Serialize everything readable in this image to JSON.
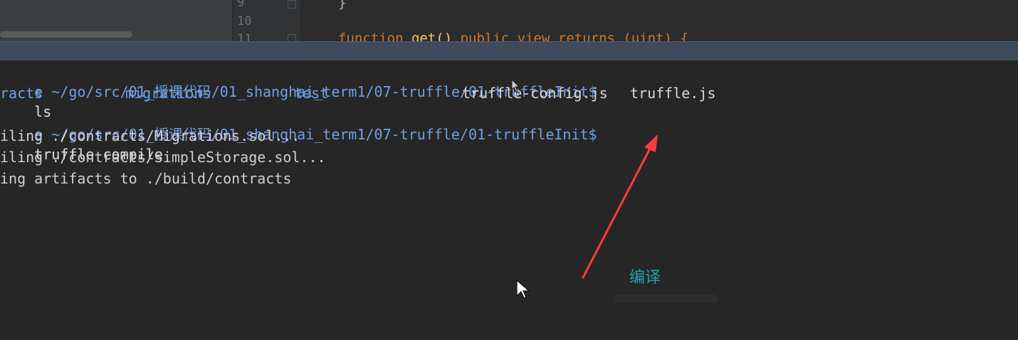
{
  "editor": {
    "line_numbers": [
      "9",
      "10",
      "11"
    ],
    "closing_brace": "}",
    "code_keyword1": "function",
    "code_fn": "get()",
    "code_rest": " public view returns (uint) {"
  },
  "terminal": {
    "prompt1": "e ~/go/src/01_授课代码/01_shanghai_term1/07-truffle/01-truffleInit$",
    "cmd1": "ls",
    "ls_items": [
      "racts",
      "migrations",
      "test",
      "truffle-config.js",
      "truffle.js"
    ],
    "prompt2": "e ~/go/src/01_授课代码/01_shanghai_term1/07-truffle/01-truffleInit$",
    "cmd2": "truffle compile",
    "out1": "iling ./contracts/Migrations.sol...",
    "out2": "iling ./contracts/SimpleStorage.sol...",
    "out3": "ing artifacts to ./build/contracts"
  },
  "annotation": {
    "label": "编译",
    "arrow_color": "#ff3b3b",
    "label_color": "#1fa6a8"
  }
}
